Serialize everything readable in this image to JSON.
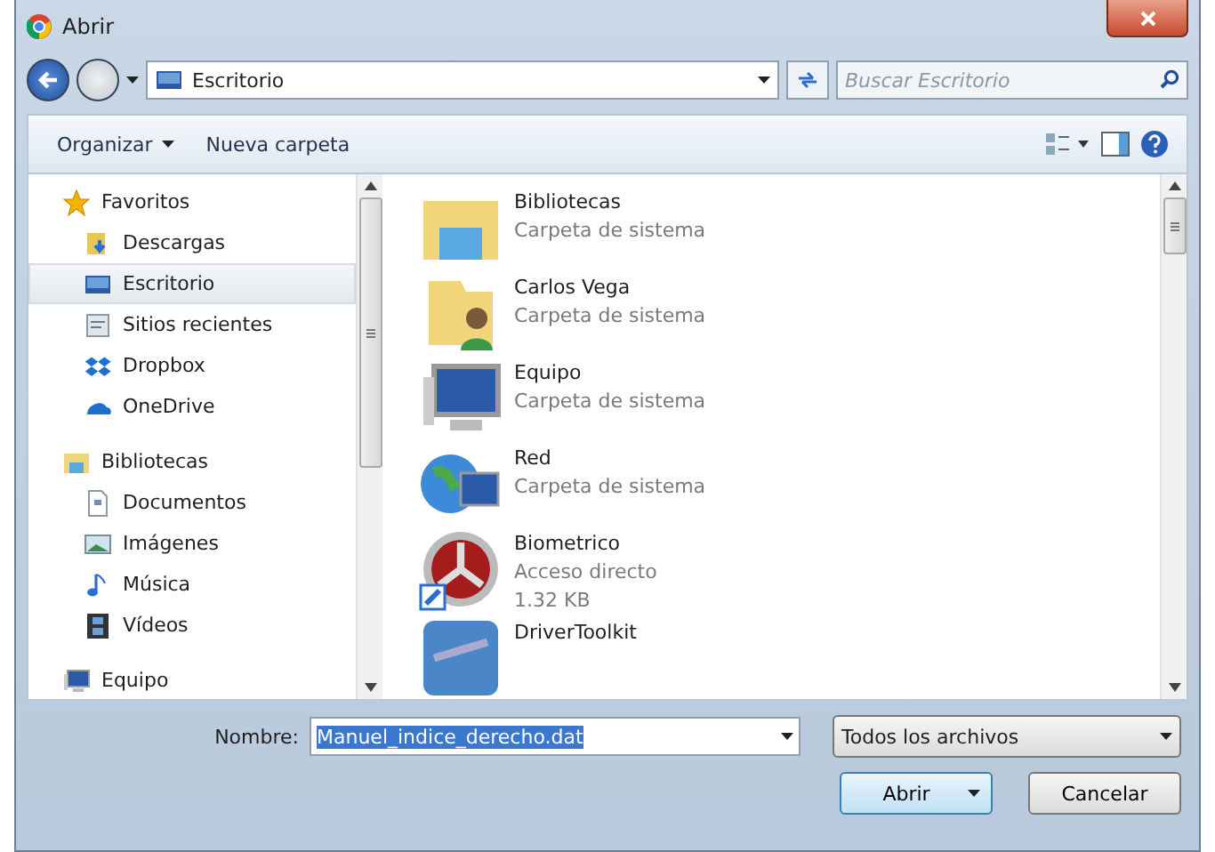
{
  "window": {
    "title": "Abrir"
  },
  "address": {
    "crumb": "Escritorio",
    "search_placeholder": "Buscar Escritorio"
  },
  "toolbar": {
    "organize": "Organizar",
    "new_folder": "Nueva carpeta"
  },
  "sidebar": {
    "sections": [
      {
        "label": "Favoritos",
        "kind": "star",
        "selected": false,
        "children": [
          {
            "label": "Descargas",
            "kind": "download",
            "selected": false
          },
          {
            "label": "Escritorio",
            "kind": "desktop",
            "selected": true
          },
          {
            "label": "Sitios recientes",
            "kind": "recent",
            "selected": false
          },
          {
            "label": "Dropbox",
            "kind": "dropbox",
            "selected": false
          },
          {
            "label": "OneDrive",
            "kind": "cloud",
            "selected": false
          }
        ]
      },
      {
        "label": "Bibliotecas",
        "kind": "library",
        "selected": false,
        "children": [
          {
            "label": "Documentos",
            "kind": "document",
            "selected": false
          },
          {
            "label": "Imágenes",
            "kind": "image",
            "selected": false
          },
          {
            "label": "Música",
            "kind": "music",
            "selected": false
          },
          {
            "label": "Vídeos",
            "kind": "video",
            "selected": false
          }
        ]
      },
      {
        "label": "Equipo",
        "kind": "computer",
        "selected": false
      }
    ]
  },
  "files": [
    {
      "name": "Bibliotecas",
      "details": [
        "Carpeta de sistema"
      ],
      "kind": "library"
    },
    {
      "name": "Carlos Vega",
      "details": [
        "Carpeta de sistema"
      ],
      "kind": "user"
    },
    {
      "name": "Equipo",
      "details": [
        "Carpeta de sistema"
      ],
      "kind": "computer"
    },
    {
      "name": "Red",
      "details": [
        "Carpeta de sistema"
      ],
      "kind": "network"
    },
    {
      "name": "Biometrico",
      "details": [
        "Acceso directo",
        "1.32 KB"
      ],
      "kind": "shortcut"
    },
    {
      "name": "DriverToolkit",
      "kind": "app"
    }
  ],
  "footer": {
    "name_label": "Nombre:",
    "name_value": "Manuel_indice_derecho.dat",
    "filter": "Todos los archivos",
    "open": "Abrir",
    "cancel": "Cancelar"
  }
}
